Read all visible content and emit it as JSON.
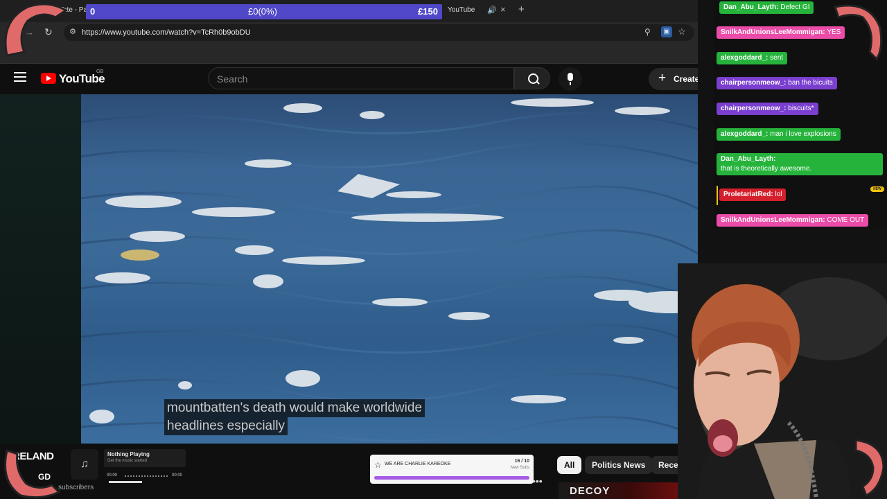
{
  "browser": {
    "tab_title": "Tate - Par",
    "tab_youtube": "YouTube",
    "url": "https://www.youtube.com/watch?v=TcRh0b9obDU",
    "audio_icon": "speaker-icon",
    "close_icon": "close-icon",
    "new_tab_icon": "plus-icon"
  },
  "donation_goal": {
    "start": "0",
    "current": "£0(0%)",
    "target": "£150",
    "progress_fraction": 0,
    "color": "#5048c8"
  },
  "youtube": {
    "logo_text": "YouTube",
    "country_code": "GB",
    "search_placeholder": "Search",
    "create_label": "Create",
    "create_icon": "plus-icon"
  },
  "video": {
    "caption_line1": "mountbatten's death would make worldwide",
    "caption_line2": "headlines especially"
  },
  "channel": {
    "name_partial": "RELAND",
    "badge": "GD",
    "subscribers_partial": "subscribers"
  },
  "music": {
    "status": "Nothing Playing",
    "subtitle": "Get the music started",
    "time_start": "00:00",
    "time_end": "00:00",
    "icon": "music-note-icon"
  },
  "sub_goal": {
    "title": "WE ARE CHARLIE KAREOKE",
    "count": "16 / 10",
    "label": "New Subs",
    "progress_fraction": 1.0,
    "color": "#a65be6"
  },
  "chips": [
    "All",
    "Politics News",
    "Recent"
  ],
  "thumbnail_text": "DECOY",
  "chat": [
    {
      "user": "Dan_Abu_Layth:",
      "text": "Defect GI",
      "color": "green"
    },
    {
      "user": "SnilkAndUnionsLeeMommigan:",
      "text": "YES",
      "color": "pink"
    },
    {
      "user": "alexgoddard_:",
      "text": "sent",
      "color": "green"
    },
    {
      "user": "chairpersonmeow_:",
      "text": "ban the bicuits",
      "color": "purple"
    },
    {
      "user": "chairpersonmeow_:",
      "text": "biscuits*",
      "color": "purple"
    },
    {
      "user": "alexgoddard_:",
      "text": "man i love explosions",
      "color": "green"
    },
    {
      "user": "Dan_Abu_Layth:",
      "text": "that is theoretically awesome.",
      "color": "green"
    },
    {
      "user": "ProletariatRed:",
      "text": "lol",
      "color": "red"
    },
    {
      "user": "SnilkAndUnionsLeeMommigan:",
      "text": "COME OUT",
      "color": "pink"
    }
  ],
  "new_badge": "NEW",
  "colors": {
    "chat_green": "#26b33c",
    "chat_pink": "#ea4ca8",
    "chat_purple": "#7a3fcf",
    "chat_red": "#d41f2c",
    "youtube_red": "#ff0000"
  }
}
